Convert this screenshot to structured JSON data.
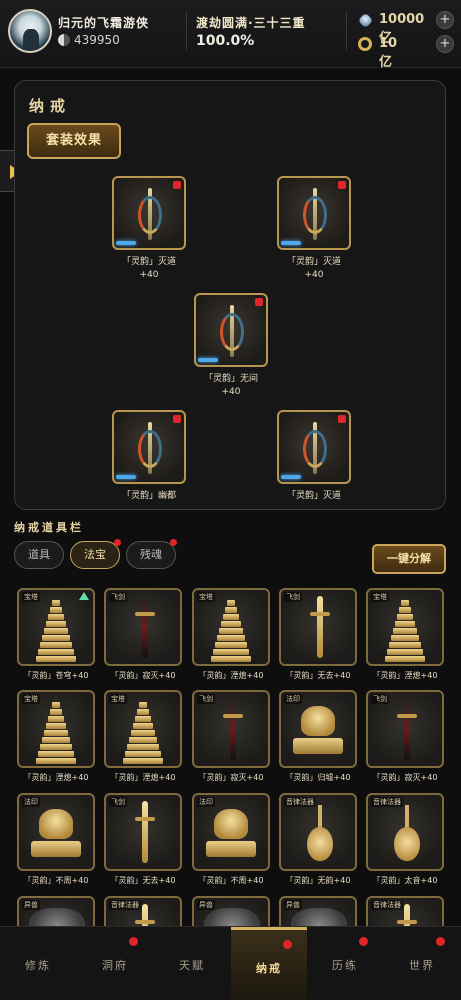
{
  "header": {
    "player_name": "归元的飞霜游侠",
    "power": "439950",
    "realm": "渡劫圆满·三十三重",
    "realm_progress": "100.0%",
    "currency1": "10000亿",
    "currency2": "10亿",
    "plus": "+",
    "icons": [
      "avatar",
      "power-icon",
      "gem-icon",
      "coin-icon"
    ]
  },
  "panel": {
    "title": "纳戒",
    "set_effect_label": "套装效果",
    "slots": [
      {
        "name": "「灵韵」灭道",
        "bonus": "+40"
      },
      {
        "name": "「灵韵」灭道",
        "bonus": "+40"
      },
      {
        "name": "「灵韵」无间",
        "bonus": "+40"
      },
      {
        "name": "「灵韵」幽都",
        "bonus": ""
      },
      {
        "name": "「灵韵」灭道",
        "bonus": ""
      }
    ]
  },
  "toolbar": {
    "title": "纳戒道具栏",
    "tabs": [
      "道具",
      "法宝",
      "残魂"
    ],
    "decompose_label": "一键分解"
  },
  "items": [
    {
      "tag": "宝塔",
      "label": "「灵韵」苍穹+40",
      "art": "pagoda"
    },
    {
      "tag": "飞剑",
      "label": "「灵韵」寂灭+40",
      "art": "blade-dark"
    },
    {
      "tag": "宝塔",
      "label": "「灵韵」湮熄+40",
      "art": "pagoda"
    },
    {
      "tag": "飞剑",
      "label": "「灵韵」无去+40",
      "art": "blade-gold"
    },
    {
      "tag": "宝塔",
      "label": "「灵韵」湮熄+40",
      "art": "pagoda"
    },
    {
      "tag": "宝塔",
      "label": "「灵韵」湮熄+40",
      "art": "pagoda"
    },
    {
      "tag": "宝塔",
      "label": "「灵韵」湮熄+40",
      "art": "pagoda"
    },
    {
      "tag": "飞剑",
      "label": "「灵韵」寂灭+40",
      "art": "blade-dark"
    },
    {
      "tag": "法印",
      "label": "「灵韵」归墟+40",
      "art": "seal"
    },
    {
      "tag": "飞剑",
      "label": "「灵韵」寂灭+40",
      "art": "blade-dark"
    },
    {
      "tag": "法印",
      "label": "「灵韵」不周+40",
      "art": "seal"
    },
    {
      "tag": "飞剑",
      "label": "「灵韵」无去+40",
      "art": "blade-gold"
    },
    {
      "tag": "法印",
      "label": "「灵韵」不周+40",
      "art": "seal"
    },
    {
      "tag": "音律法器",
      "label": "「灵韵」无韵+40",
      "art": "pipa"
    },
    {
      "tag": "音律法器",
      "label": "「灵韵」太音+40",
      "art": "pipa"
    },
    {
      "tag": "异兽",
      "label": "",
      "art": "stone"
    },
    {
      "tag": "音律法器",
      "label": "",
      "art": "blade-gold"
    },
    {
      "tag": "异兽",
      "label": "",
      "art": "stone"
    },
    {
      "tag": "异兽",
      "label": "",
      "art": "stone"
    },
    {
      "tag": "音律法器",
      "label": "",
      "art": "blade-gold"
    }
  ],
  "nav": [
    {
      "label": "修炼",
      "dot": false,
      "active": false
    },
    {
      "label": "洞府",
      "dot": true,
      "active": false
    },
    {
      "label": "天赋",
      "dot": false,
      "active": false
    },
    {
      "label": "纳戒",
      "dot": true,
      "active": true
    },
    {
      "label": "历练",
      "dot": true,
      "active": false
    },
    {
      "label": "世界",
      "dot": true,
      "active": false
    }
  ]
}
